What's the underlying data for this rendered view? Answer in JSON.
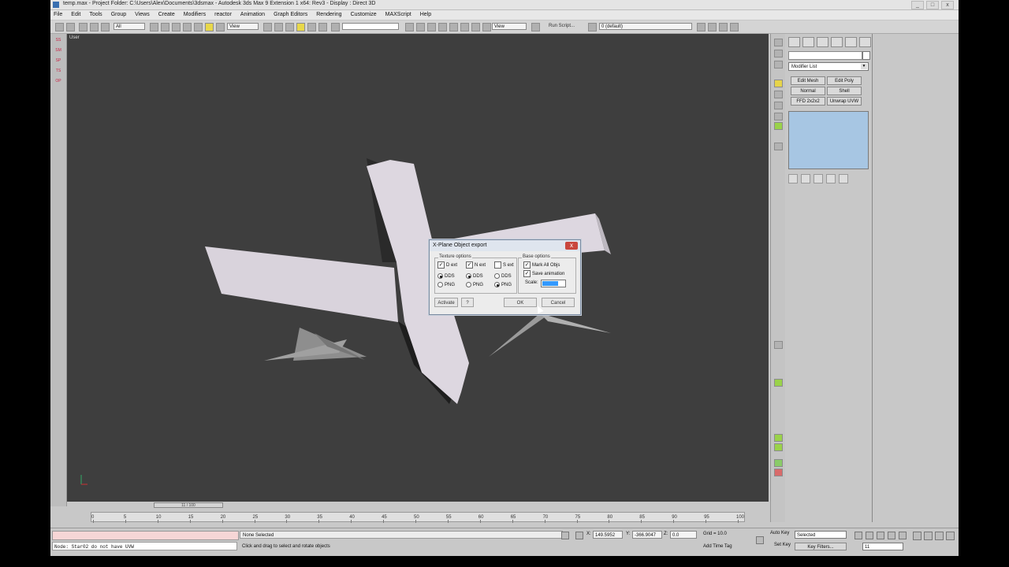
{
  "window": {
    "title": "temp.max    - Project Folder: C:\\Users\\Alex\\Documents\\3dsmax    - Autodesk 3ds Max 9 Extension 1 x64: Rev3    - Display : Direct 3D",
    "controls": [
      "_",
      "□",
      "x"
    ]
  },
  "menu": [
    "File",
    "Edit",
    "Tools",
    "Group",
    "Views",
    "Create",
    "Modifiers",
    "reactor",
    "Animation",
    "Graph Editors",
    "Rendering",
    "Customize",
    "MAXScript",
    "Help"
  ],
  "toolbar": {
    "selection_filter": "All",
    "ref_coord": "View",
    "ref_coord2": "View",
    "run_script": "Run Script...",
    "layer": "0 (default)"
  },
  "left_strip": [
    "SS",
    "SM",
    "SP",
    "TS",
    "OP"
  ],
  "viewport": {
    "label": "User"
  },
  "command_panel": {
    "modifier_list": "Modifier List",
    "modifier_buttons": [
      "Edit Mesh",
      "Edit Poly",
      "Normal",
      "Shell",
      "FFD 2x2x2",
      "Unwrap UVW"
    ]
  },
  "dialog": {
    "title": "X-Plane Object export",
    "close": "x",
    "texture_group": "Texture options",
    "base_group": "Base options",
    "textures": [
      {
        "label": "D ext",
        "checked": true,
        "formats": [
          "DDS",
          "PNG"
        ],
        "selected": "DDS"
      },
      {
        "label": "N ext",
        "checked": true,
        "formats": [
          "DDS",
          "PNG"
        ],
        "selected": "DDS"
      },
      {
        "label": "S ext",
        "checked": false,
        "formats": [
          "DDS",
          "PNG"
        ],
        "selected": "PNG"
      }
    ],
    "mark_all_objs": "Mark All Objs",
    "save_animation": "Save animation",
    "scale_label": "Scale:",
    "buttons": {
      "activate": "Activate",
      "help": "?",
      "ok": "OK",
      "cancel": "Cancel"
    }
  },
  "timeline": {
    "slider": "11 / 100",
    "ticks": [
      "0",
      "5",
      "10",
      "15",
      "20",
      "25",
      "30",
      "35",
      "40",
      "45",
      "50",
      "55",
      "60",
      "65",
      "70",
      "75",
      "80",
      "85",
      "90",
      "95",
      "100"
    ]
  },
  "status": {
    "maxscript_output": "Node: Star02 do not have UVW",
    "selection": "None Selected",
    "prompt": "Click and drag to select and rotate objects",
    "x_label": "X:",
    "x_value": "149.5952",
    "y_label": "Y:",
    "y_value": "-366.9047",
    "z_label": "Z:",
    "z_value": "0.0",
    "grid": "Grid = 10.0",
    "add_time_tag": "Add Time Tag",
    "auto_key": "Auto Key",
    "set_key": "Set Key",
    "key_mode": "Selected",
    "key_filters": "Key Filters...",
    "frame": "11"
  }
}
